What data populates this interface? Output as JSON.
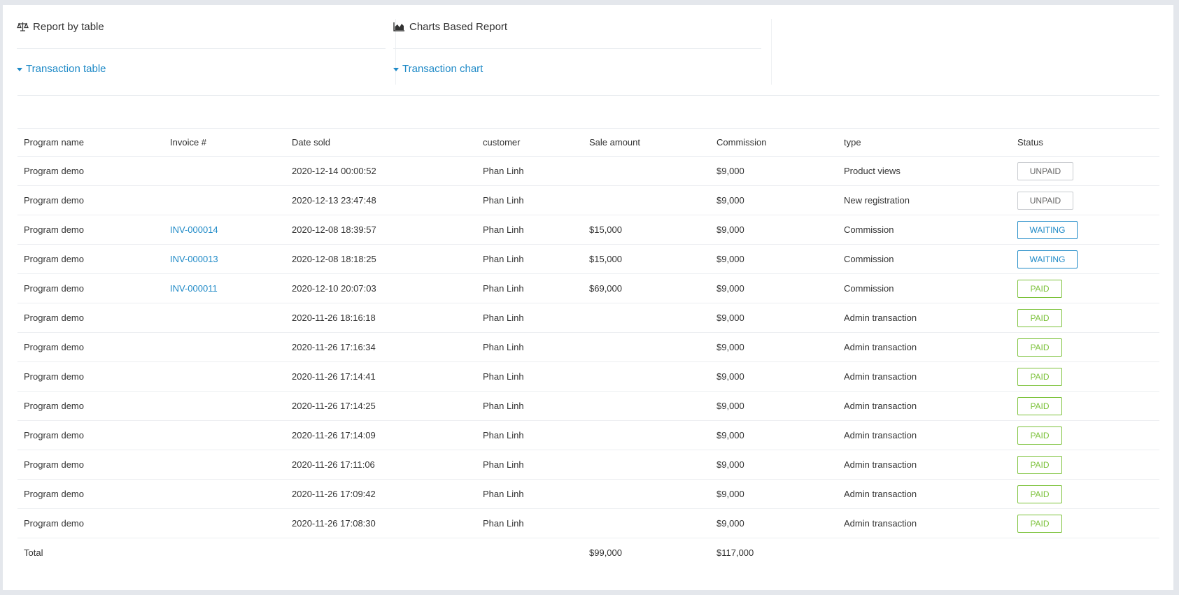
{
  "reports": {
    "by_table": {
      "title": "Report by table",
      "icon": "balance-scale-icon",
      "link": "Transaction table"
    },
    "charts": {
      "title": "Charts Based Report",
      "icon": "area-chart-icon",
      "link": "Transaction chart"
    }
  },
  "table": {
    "headers": [
      "Program name",
      "Invoice #",
      "Date sold",
      "customer",
      "Sale amount",
      "Commission",
      "type",
      "Status"
    ],
    "rows": [
      {
        "program": "Program demo",
        "invoice": "",
        "date": "2020-12-14 00:00:52",
        "customer": "Phan Linh",
        "sale": "",
        "commission": "$9,000",
        "type": "Product views",
        "status": "UNPAID"
      },
      {
        "program": "Program demo",
        "invoice": "",
        "date": "2020-12-13 23:47:48",
        "customer": "Phan Linh",
        "sale": "",
        "commission": "$9,000",
        "type": "New registration",
        "status": "UNPAID"
      },
      {
        "program": "Program demo",
        "invoice": "INV-000014",
        "date": "2020-12-08 18:39:57",
        "customer": "Phan Linh",
        "sale": "$15,000",
        "commission": "$9,000",
        "type": "Commission",
        "status": "WAITING"
      },
      {
        "program": "Program demo",
        "invoice": "INV-000013",
        "date": "2020-12-08 18:18:25",
        "customer": "Phan Linh",
        "sale": "$15,000",
        "commission": "$9,000",
        "type": "Commission",
        "status": "WAITING"
      },
      {
        "program": "Program demo",
        "invoice": "INV-000011",
        "date": "2020-12-10 20:07:03",
        "customer": "Phan Linh",
        "sale": "$69,000",
        "commission": "$9,000",
        "type": "Commission",
        "status": "PAID"
      },
      {
        "program": "Program demo",
        "invoice": "",
        "date": "2020-11-26 18:16:18",
        "customer": "Phan Linh",
        "sale": "",
        "commission": "$9,000",
        "type": "Admin transaction",
        "status": "PAID"
      },
      {
        "program": "Program demo",
        "invoice": "",
        "date": "2020-11-26 17:16:34",
        "customer": "Phan Linh",
        "sale": "",
        "commission": "$9,000",
        "type": "Admin transaction",
        "status": "PAID"
      },
      {
        "program": "Program demo",
        "invoice": "",
        "date": "2020-11-26 17:14:41",
        "customer": "Phan Linh",
        "sale": "",
        "commission": "$9,000",
        "type": "Admin transaction",
        "status": "PAID"
      },
      {
        "program": "Program demo",
        "invoice": "",
        "date": "2020-11-26 17:14:25",
        "customer": "Phan Linh",
        "sale": "",
        "commission": "$9,000",
        "type": "Admin transaction",
        "status": "PAID"
      },
      {
        "program": "Program demo",
        "invoice": "",
        "date": "2020-11-26 17:14:09",
        "customer": "Phan Linh",
        "sale": "",
        "commission": "$9,000",
        "type": "Admin transaction",
        "status": "PAID"
      },
      {
        "program": "Program demo",
        "invoice": "",
        "date": "2020-11-26 17:11:06",
        "customer": "Phan Linh",
        "sale": "",
        "commission": "$9,000",
        "type": "Admin transaction",
        "status": "PAID"
      },
      {
        "program": "Program demo",
        "invoice": "",
        "date": "2020-11-26 17:09:42",
        "customer": "Phan Linh",
        "sale": "",
        "commission": "$9,000",
        "type": "Admin transaction",
        "status": "PAID"
      },
      {
        "program": "Program demo",
        "invoice": "",
        "date": "2020-11-26 17:08:30",
        "customer": "Phan Linh",
        "sale": "",
        "commission": "$9,000",
        "type": "Admin transaction",
        "status": "PAID"
      }
    ],
    "total": {
      "label": "Total",
      "sale": "$99,000",
      "commission": "$117,000"
    }
  },
  "colors": {
    "link": "#1f8ac7",
    "paid": "#7cc23a",
    "waiting": "#1f8ac7",
    "unpaid": "#666666"
  }
}
